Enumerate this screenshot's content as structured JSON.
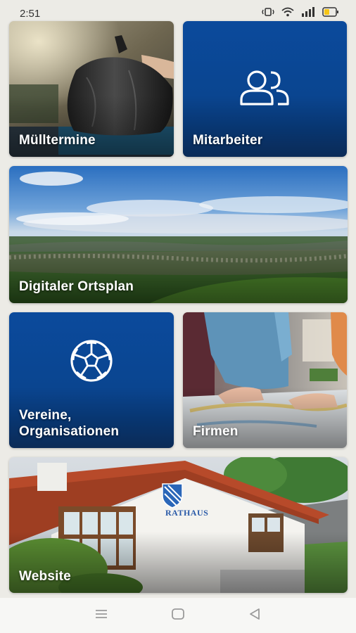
{
  "status_bar": {
    "time": "2:51",
    "icons": [
      "vibrate-icon",
      "wifi-icon",
      "signal-icon",
      "battery-icon"
    ]
  },
  "tiles": {
    "muelltermine": {
      "label": "Mülltermine",
      "image": "garbage-bag-photo"
    },
    "mitarbeiter": {
      "label": "Mitarbeiter",
      "icon": "users-icon"
    },
    "ortsplan": {
      "label": "Digitaler Ortsplan",
      "image": "town-landscape-photo"
    },
    "vereine": {
      "label_line1": "Vereine,",
      "label_line2": "Organisationen",
      "icon": "soccer-ball-icon"
    },
    "firmen": {
      "label": "Firmen",
      "image": "office-meeting-photo"
    },
    "website": {
      "label": "Website",
      "image": "town-hall-photo",
      "sign_text": "RATHAUS"
    }
  },
  "nav_bar": {
    "icons": [
      "menu-icon",
      "home-icon",
      "back-icon"
    ]
  },
  "colors": {
    "tile_blue": "#0a4590",
    "tile_blue_dark": "#0b2b57",
    "background": "#ecebe6"
  }
}
